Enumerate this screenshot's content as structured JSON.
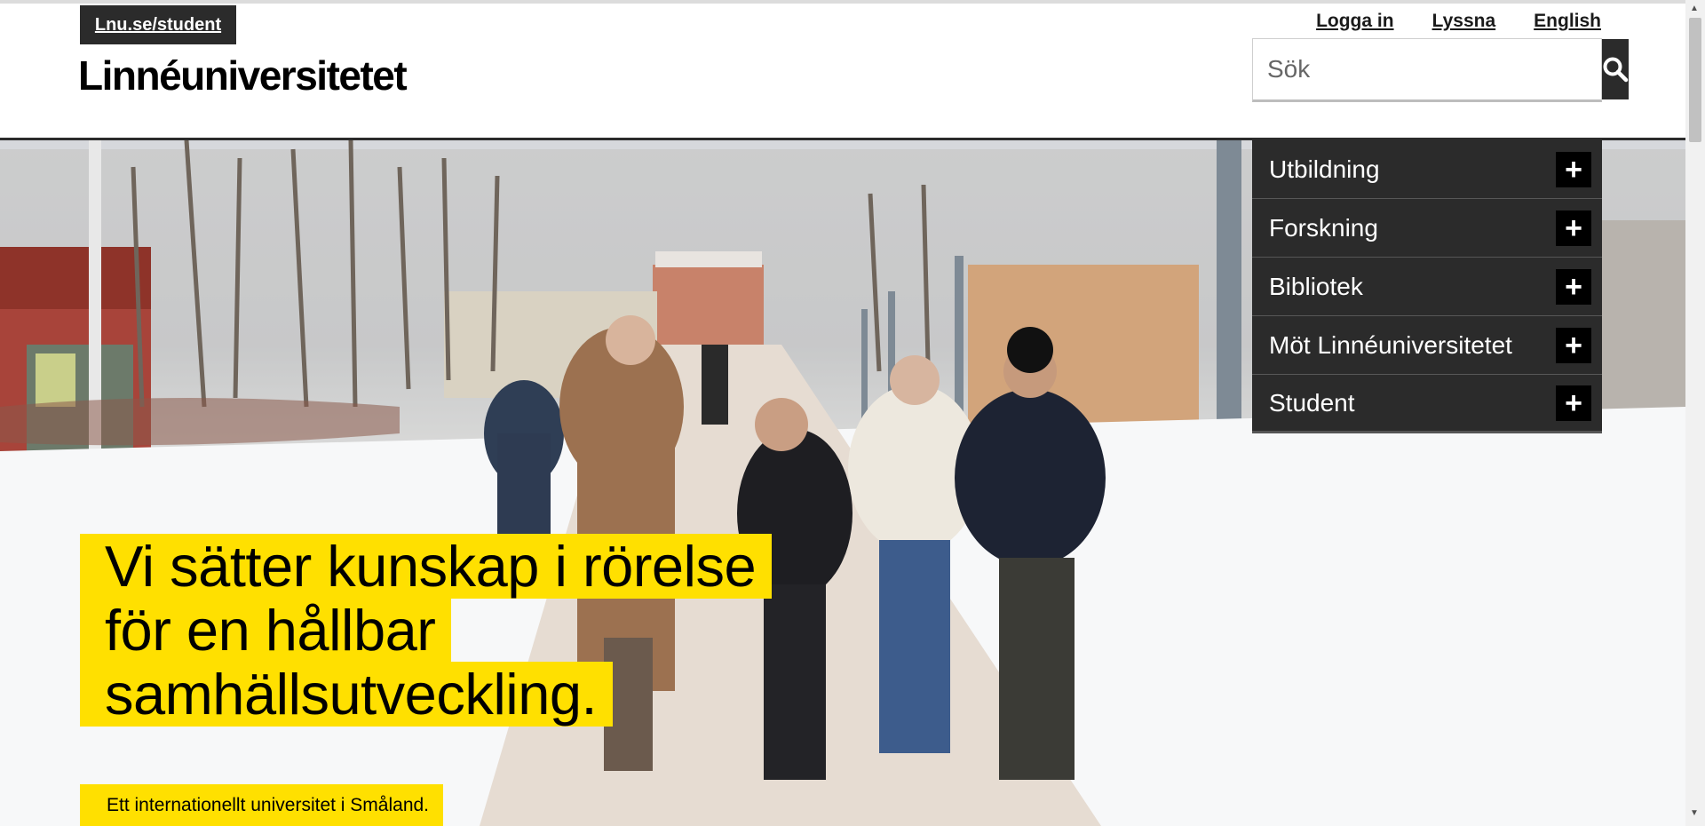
{
  "header": {
    "student_link": "Lnu.se/student",
    "logo": "Linnéuniversitetet",
    "links": [
      "Logga in",
      "Lyssna",
      "English"
    ]
  },
  "search": {
    "placeholder": "Sök",
    "button_icon": "search-icon"
  },
  "nav": {
    "items": [
      {
        "label": "Utbildning",
        "icon": "plus-icon"
      },
      {
        "label": "Forskning",
        "icon": "plus-icon"
      },
      {
        "label": "Bibliotek",
        "icon": "plus-icon"
      },
      {
        "label": "Möt Linnéuniversitetet",
        "icon": "plus-icon"
      },
      {
        "label": "Student",
        "icon": "plus-icon"
      }
    ]
  },
  "hero": {
    "headline": "Vi sätter kunskap i rörelse för en hållbar samhällsutveckling.",
    "subline": "Ett internationellt universitet i Småland."
  },
  "colors": {
    "accent": "#ffe000",
    "dark": "#2b2b2b"
  }
}
